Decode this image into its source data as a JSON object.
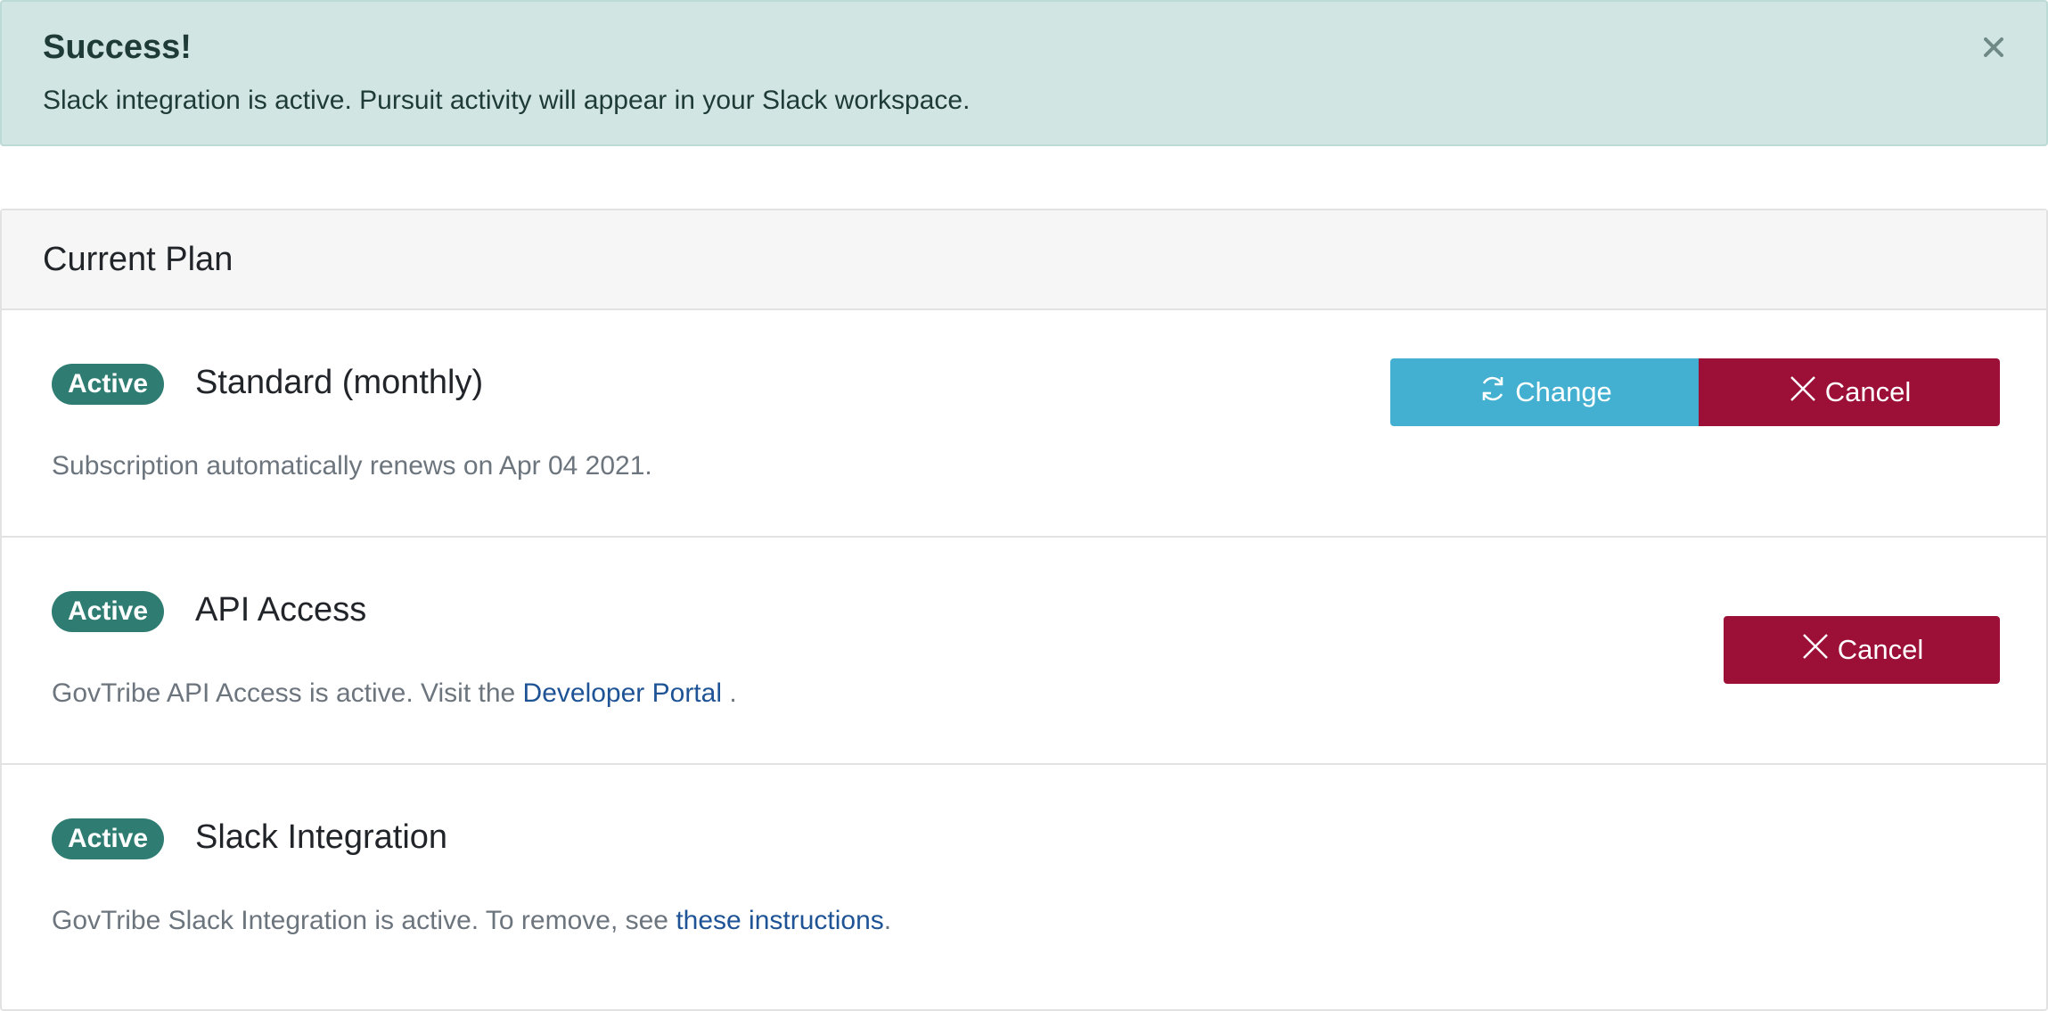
{
  "alert": {
    "title": "Success!",
    "message": "Slack integration is active. Pursuit activity will appear in your Slack workspace.",
    "close_icon": "close-icon"
  },
  "card": {
    "title": "Current Plan",
    "rows": [
      {
        "badge": "Active",
        "title": "Standard (monthly)",
        "description": "Subscription automatically renews on Apr 04 2021.",
        "buttons": {
          "change": "Change",
          "cancel": "Cancel"
        }
      },
      {
        "badge": "Active",
        "title": "API Access",
        "description_prefix": "GovTribe API Access is active. Visit the ",
        "link": "Developer Portal",
        "description_suffix": " .",
        "buttons": {
          "cancel": "Cancel"
        }
      },
      {
        "badge": "Active",
        "title": "Slack Integration",
        "description_prefix": "GovTribe Slack Integration is active. To remove, see ",
        "link": "these instructions",
        "description_suffix": "."
      }
    ]
  },
  "colors": {
    "alert_bg": "#d1e5e2",
    "badge": "#2f7d72",
    "change_button": "#44b0d1",
    "cancel_button": "#9c1038",
    "link": "#1e5395"
  }
}
